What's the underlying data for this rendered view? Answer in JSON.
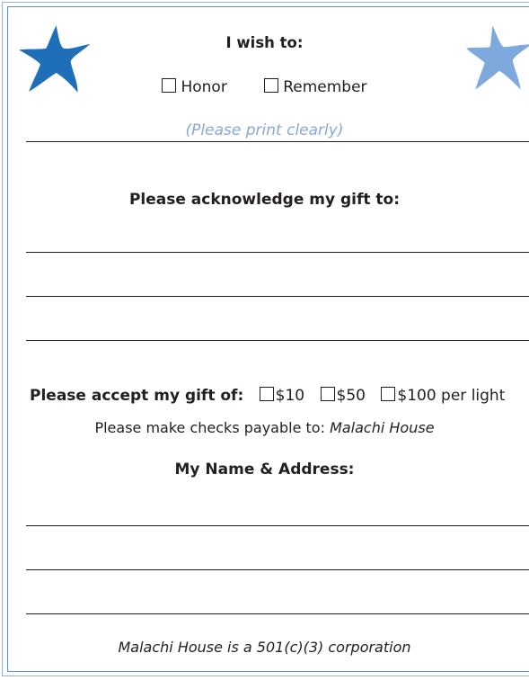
{
  "form": {
    "wish_heading": "I wish to:",
    "options": [
      {
        "label": "Honor"
      },
      {
        "label": "Remember"
      }
    ],
    "print_note": "(Please print clearly)",
    "acknowledge_heading": "Please acknowledge my gift to:",
    "gift": {
      "label": "Please accept my gift of:",
      "amounts": [
        "$10",
        "$50",
        "$100"
      ],
      "suffix": "per light"
    },
    "checks": {
      "prefix": "Please make checks payable to:",
      "payee": "Malachi House"
    },
    "name_heading": "My Name & Address:",
    "footer": "Malachi House is a 501(c)(3) corporation"
  },
  "colors": {
    "star_dark": "#1f6fb8",
    "star_light": "#7ea9dc",
    "note": "#8aa7d6",
    "border": "#5b8fcb"
  }
}
